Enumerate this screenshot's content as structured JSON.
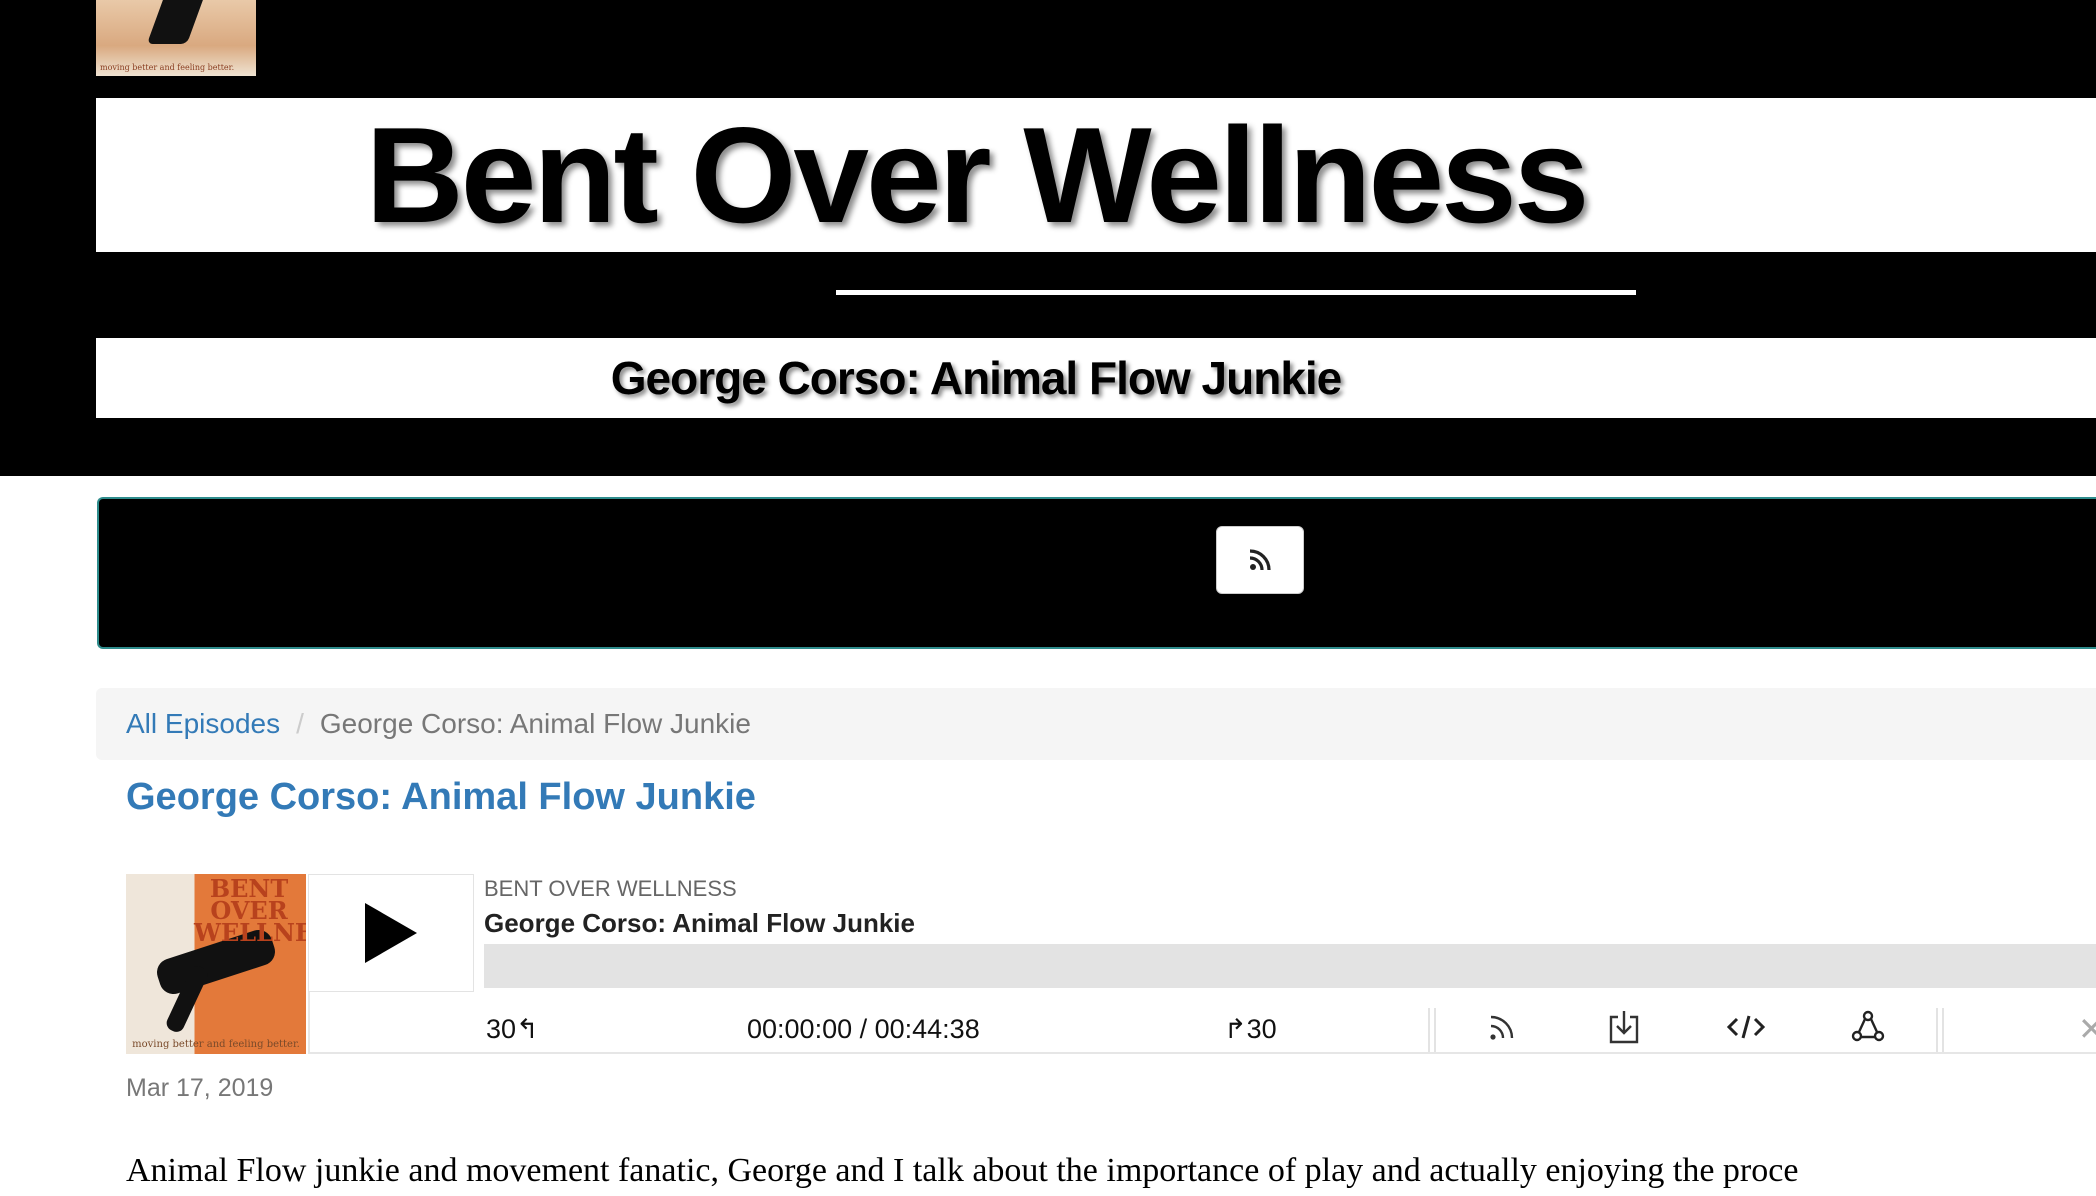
{
  "site": {
    "title": "Bent Over Wellness",
    "subtitle": "George Corso: Animal Flow Junkie",
    "logo_tagline": "moving better and feeling better."
  },
  "nav": {
    "rss_icon": "rss-icon"
  },
  "breadcrumb": {
    "home_label": "All Episodes",
    "separator": "/",
    "current": "George Corso: Animal Flow Junkie"
  },
  "episode": {
    "title": "George Corso: Animal Flow Junkie",
    "date": "Mar 17, 2019",
    "description": "Animal Flow junkie and movement fanatic, George and I talk about the importance of play and actually enjoying the proce"
  },
  "player": {
    "cover_title": "BENT\nOVER\nWELLNESS",
    "cover_tagline": "moving better and feeling better.",
    "podcast_name": "BENT OVER WELLNESS",
    "episode_title": "George Corso: Animal Flow Junkie",
    "rewind_label": "30↰",
    "time_display": "00:00:00 / 00:44:38",
    "forward_label": "↱30",
    "progress_fraction": 0,
    "icons": [
      "subscribe-icon",
      "download-icon",
      "embed-icon",
      "share-icon"
    ],
    "close_label": "✕"
  },
  "colors": {
    "link": "#337ab7",
    "header_bg": "#000000",
    "breadcrumb_bg": "#f5f5f5"
  }
}
